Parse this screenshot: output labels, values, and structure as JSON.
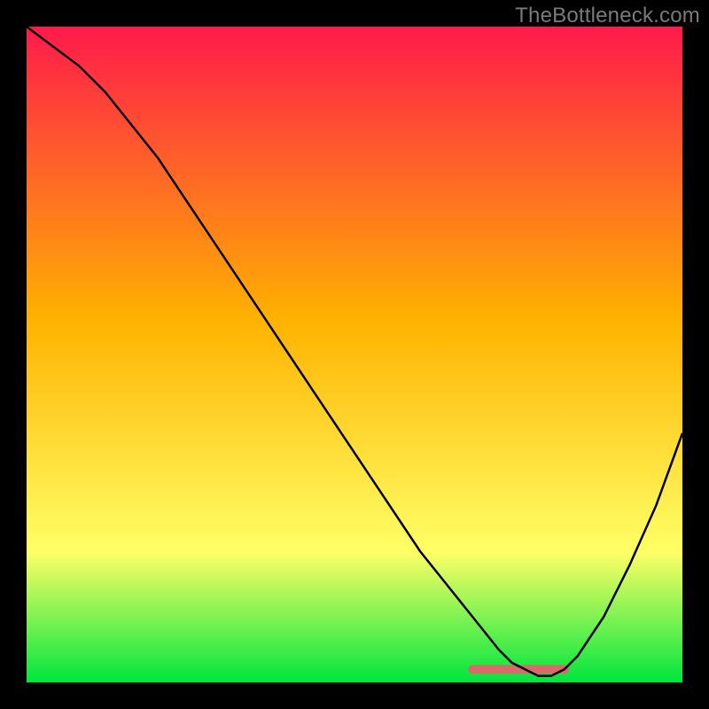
{
  "attribution": "TheBottleneck.com",
  "colors": {
    "gradient_top": "#ff1a4b",
    "gradient_mid": "#ffb300",
    "gradient_low": "#ffff66",
    "gradient_bottom": "#00e63f",
    "curve": "#000000",
    "accent_band": "#d86a6a",
    "background": "#000000"
  },
  "chart_data": {
    "type": "line",
    "title": "",
    "xlabel": "",
    "ylabel": "",
    "xlim": [
      0,
      100
    ],
    "ylim": [
      0,
      100
    ],
    "series": [
      {
        "name": "bottleneck-curve",
        "x": [
          0,
          4,
          8,
          12,
          16,
          20,
          24,
          28,
          32,
          36,
          40,
          44,
          48,
          52,
          56,
          60,
          64,
          68,
          72,
          74,
          76,
          78,
          80,
          82,
          84,
          88,
          92,
          96,
          100
        ],
        "values": [
          100,
          97,
          94,
          90,
          85,
          80,
          74,
          68,
          62,
          56,
          50,
          44,
          38,
          32,
          26,
          20,
          15,
          10,
          5,
          3,
          2,
          1,
          1,
          2,
          4,
          10,
          18,
          27,
          38
        ]
      }
    ],
    "accent_flat_segment": {
      "x_start": 68,
      "x_end": 82,
      "y": 2
    }
  }
}
